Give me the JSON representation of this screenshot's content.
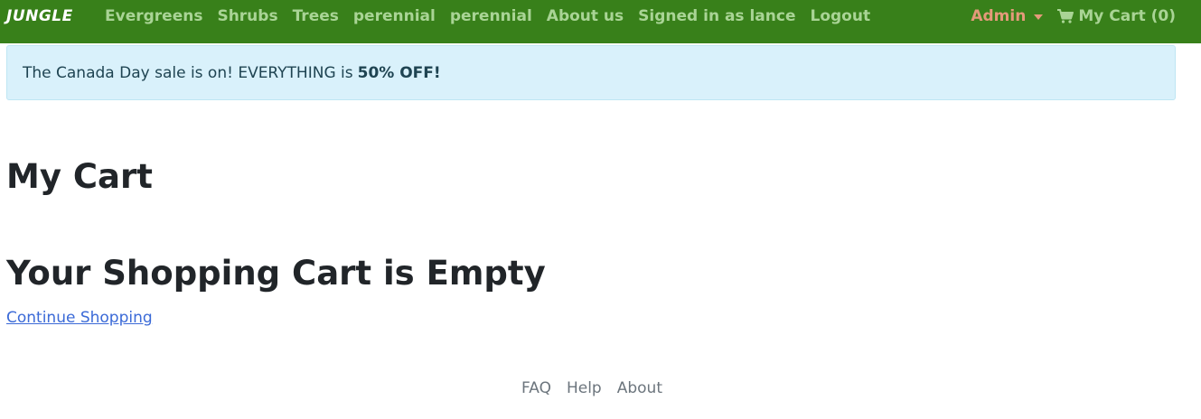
{
  "navbar": {
    "brand": "JUNGLE",
    "links": [
      "Evergreens",
      "Shrubs",
      "Trees",
      "perennial",
      "perennial",
      "About us",
      "Signed in as lance",
      "Logout"
    ],
    "admin_label": "Admin",
    "cart_label": "My Cart (0)",
    "background_color": "#38801a",
    "link_color": "#a9d495",
    "admin_color": "#e49a7a"
  },
  "alert": {
    "text": "The Canada Day sale is on! EVERYTHING is",
    "emphasis": "50% OFF!"
  },
  "main": {
    "page_title": "My Cart",
    "empty_heading": "Your Shopping Cart is Empty",
    "continue_link": "Continue Shopping"
  },
  "footer": {
    "links": [
      "FAQ",
      "Help",
      "About"
    ]
  },
  "icons": {
    "cart": "shopping-cart-icon",
    "admin_dropdown": "caret-down-icon"
  }
}
